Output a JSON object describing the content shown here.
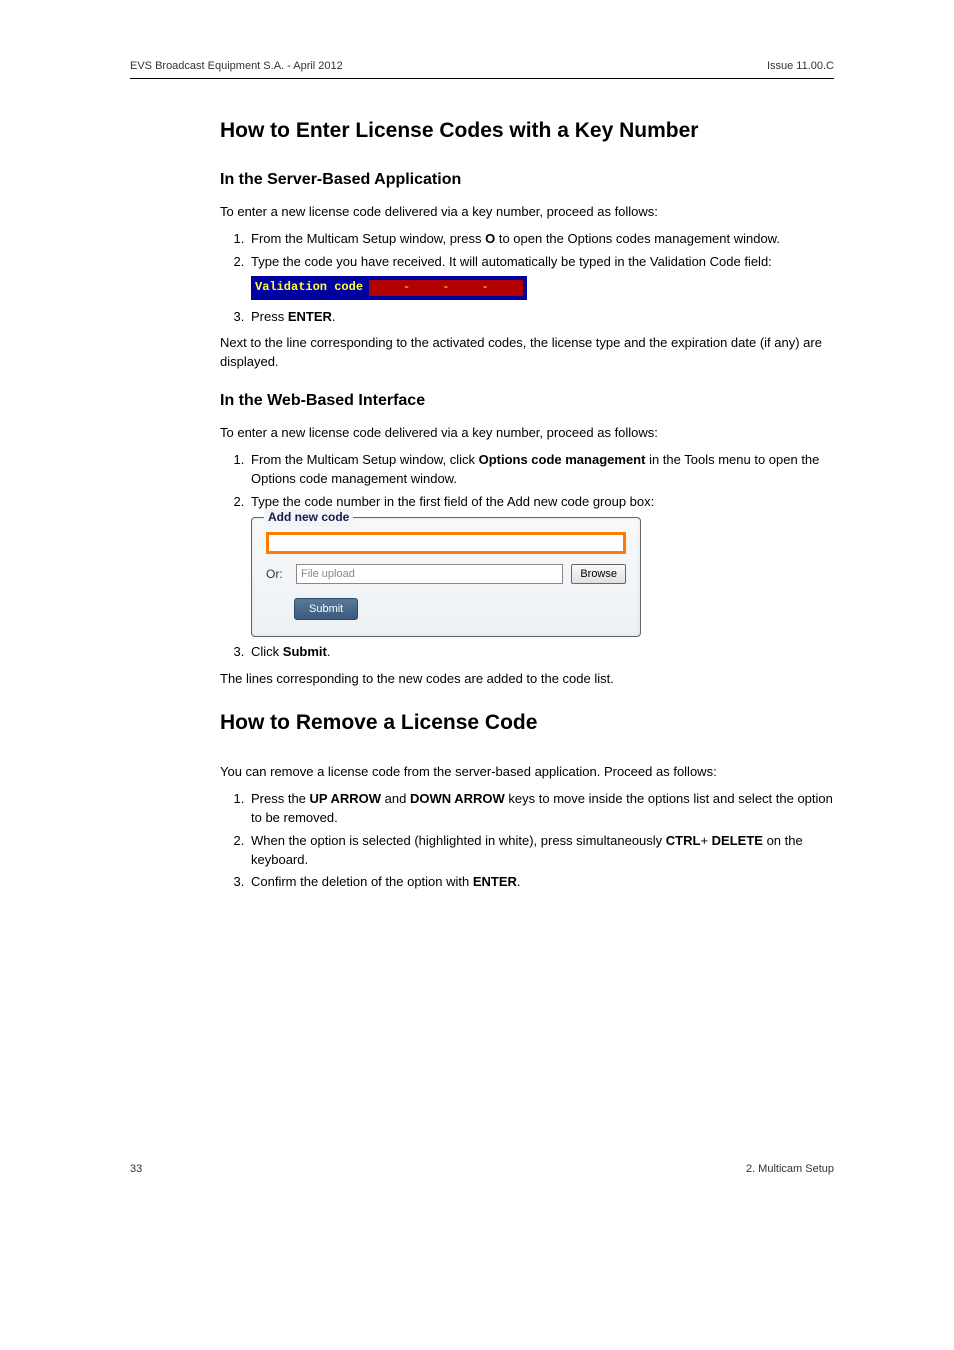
{
  "header": {
    "left": "EVS Broadcast Equipment S.A.  - April 2012",
    "right": "Issue 11.00.C"
  },
  "section1": {
    "title": "How to Enter License Codes with a Key Number",
    "sub1": {
      "title": "In the Server-Based Application",
      "intro": "To enter a new license code delivered via a key number, proceed as follows:",
      "step1_a": "From the Multicam Setup window, press ",
      "step1_key": "O",
      "step1_b": " to open the Options codes management window.",
      "step2": "Type the code you have received. It will automatically be typed in the Validation Code field:",
      "val_label": "Validation code",
      "dash": "-",
      "step3_a": "Press ",
      "step3_key": "ENTER",
      "step3_b": ".",
      "outro": "Next to the line corresponding to the activated codes, the license type and the expiration date (if any) are displayed."
    },
    "sub2": {
      "title": "In the Web-Based Interface",
      "intro": "To enter a new license code delivered via a key number, proceed as follows:",
      "step1_a": "From the Multicam Setup window, click ",
      "step1_bold": "Options code management",
      "step1_b": " in the Tools menu to open the Options code management window.",
      "step2": "Type the code number in the first field of the Add new code group box:",
      "fieldset_legend": "Add new code",
      "or_label": "Or:",
      "file_placeholder": "File upload",
      "browse_label": "Browse",
      "submit_label": "Submit",
      "step3_a": "Click ",
      "step3_bold": "Submit",
      "step3_b": ".",
      "outro": "The lines corresponding to the new codes are added to the code list."
    }
  },
  "section2": {
    "title": "How to Remove a License Code",
    "intro": "You can remove a license code from the server-based application. Proceed as follows:",
    "step1_a": "Press the ",
    "step1_b1": "UP ARROW",
    "step1_mid": " and ",
    "step1_b2": "DOWN ARROW",
    "step1_c": " keys to move inside the options list and select the option to be removed.",
    "step2_a": "When the option is selected (highlighted in white), press simultaneously ",
    "step2_b1": "CTRL",
    "step2_plus": "+ ",
    "step2_b2": "DELETE",
    "step2_c": " on the keyboard.",
    "step3_a": "Confirm the deletion of the option with ",
    "step3_b": "ENTER",
    "step3_c": "."
  },
  "footer": {
    "left": "33",
    "right": "2. Multicam Setup"
  }
}
